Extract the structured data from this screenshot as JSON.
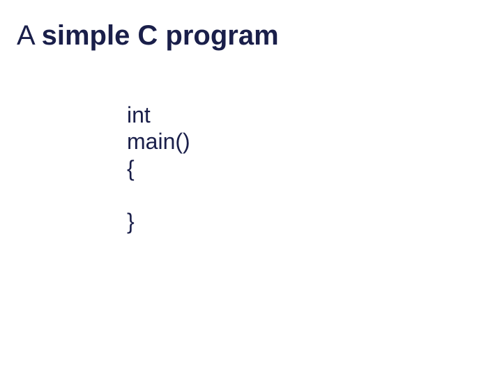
{
  "slide": {
    "title_prefix": "A ",
    "title_bold": "simple C program",
    "code": {
      "line1": "int",
      "line2": "main()",
      "line3": "{",
      "line4": "}"
    }
  }
}
